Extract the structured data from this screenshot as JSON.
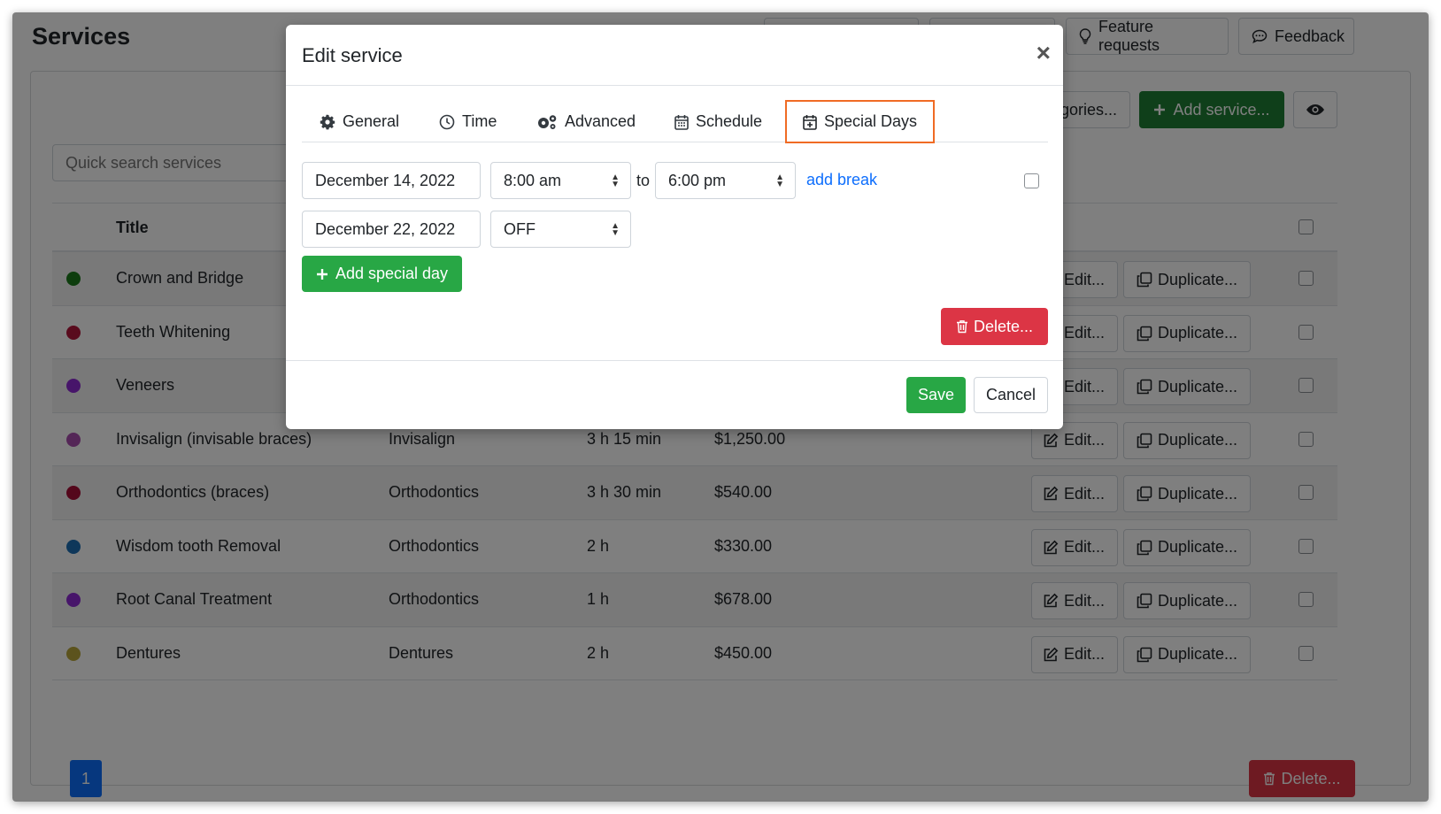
{
  "page": {
    "title": "Services"
  },
  "top_buttons": {
    "feature_requests": "Feature requests",
    "feedback": "Feedback"
  },
  "toolbar": {
    "categories_label": "gories...",
    "add_service_label": "Add service..."
  },
  "search": {
    "placeholder": "Quick search services"
  },
  "table": {
    "header_title": "Title",
    "edit_label": "Edit...",
    "duplicate_label": "Duplicate...",
    "rows": [
      {
        "color": "#1b7a1b",
        "title": "Crown and Bridge",
        "category": "",
        "duration": "",
        "price": ""
      },
      {
        "color": "#b3163a",
        "title": "Teeth Whitening",
        "category": "",
        "duration": "",
        "price": ""
      },
      {
        "color": "#8e2bd4",
        "title": "Veneers",
        "category": "",
        "duration": "",
        "price": ""
      },
      {
        "color": "#a94dae",
        "title": "Invisalign (invisable braces)",
        "category": "Invisalign",
        "duration": "3 h 15 min",
        "price": "$1,250.00"
      },
      {
        "color": "#a80e36",
        "title": "Orthodontics (braces)",
        "category": "Orthodontics",
        "duration": "3 h 30 min",
        "price": "$540.00"
      },
      {
        "color": "#1c6fb4",
        "title": "Wisdom tooth Removal",
        "category": "Orthodontics",
        "duration": "2 h",
        "price": "$330.00"
      },
      {
        "color": "#8e2bd4",
        "title": "Root Canal Treatment",
        "category": "Orthodontics",
        "duration": "1 h",
        "price": "$678.00"
      },
      {
        "color": "#b8a63a",
        "title": "Dentures",
        "category": "Dentures",
        "duration": "2 h",
        "price": "$450.00"
      }
    ]
  },
  "pagination": {
    "current_page": "1"
  },
  "bottom": {
    "delete_label": "Delete..."
  },
  "modal": {
    "title": "Edit service",
    "close_label": "×",
    "tabs": [
      {
        "label": "General",
        "icon": "gear-icon"
      },
      {
        "label": "Time",
        "icon": "clock-icon"
      },
      {
        "label": "Advanced",
        "icon": "gears-icon"
      },
      {
        "label": "Schedule",
        "icon": "calendar-icon"
      },
      {
        "label": "Special Days",
        "icon": "calendar-plus-icon",
        "active": true
      }
    ],
    "special_days": [
      {
        "date": "December 14, 2022",
        "start": "8:00 am",
        "to_label": "to",
        "end": "6:00 pm",
        "add_break_label": "add break"
      },
      {
        "date": "December 22, 2022",
        "start": "OFF"
      }
    ],
    "add_special_day_label": "Add special day",
    "delete_label": "Delete...",
    "save_label": "Save",
    "cancel_label": "Cancel"
  },
  "colors": {
    "accent_green": "#28a745",
    "dark_green": "#1e7e34",
    "danger": "#dc3545",
    "primary": "#0d6efd",
    "tab_highlight": "#f06b24"
  }
}
